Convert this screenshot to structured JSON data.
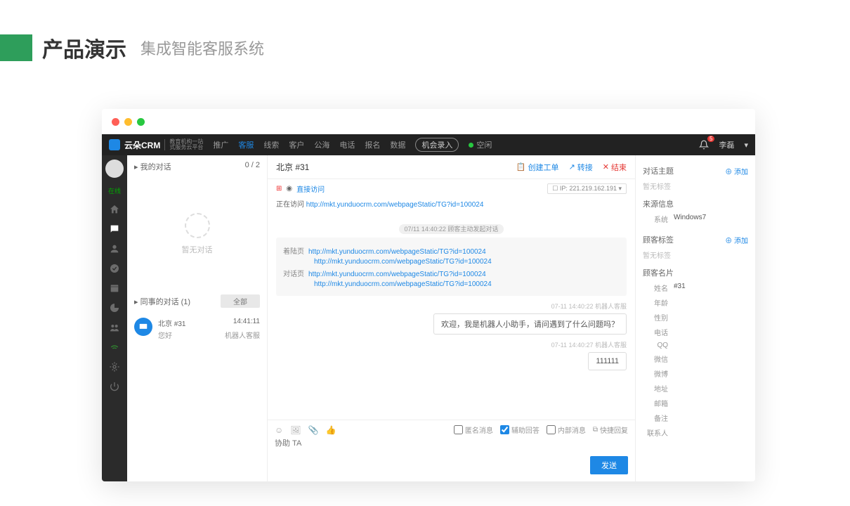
{
  "slide": {
    "title_main": "产品演示",
    "title_sub": "集成智能客服系统"
  },
  "brand": {
    "name": "云朵CRM",
    "sub1": "教育机构一站",
    "sub2": "式服务云平台"
  },
  "nav": {
    "items": [
      "推广",
      "客服",
      "线索",
      "客户",
      "公海",
      "电话",
      "报名",
      "数据"
    ],
    "active_index": 1,
    "record_btn": "机会录入",
    "status": "空闲",
    "user": "李磊",
    "badge": "5"
  },
  "rail": {
    "status": "在线"
  },
  "chats": {
    "my_header": "我的对话",
    "my_count": "0 / 2",
    "empty": "暂无对话",
    "peer_header": "同事的对话  (1)",
    "all_btn": "全部",
    "items": [
      {
        "title": "北京 #31",
        "time": "14:41:11",
        "preview": "您好",
        "agent": "机器人客服"
      }
    ]
  },
  "conv": {
    "title": "北京 #31",
    "actions": {
      "ticket": "创建工单",
      "transfer": "转接",
      "end": "结束"
    },
    "visit_label": "直接访问",
    "ip_label": "IP:",
    "ip": "221.219.162.191",
    "visiting_label": "正在访问",
    "visiting_url": "http://mkt.yunduocrm.com/webpageStatic/TG?id=100024",
    "sys_pill": "07/11 14:40:22  顾客主动发起对话",
    "info": {
      "landing_label": "着陆页",
      "landing_urls": [
        "http://mkt.yunduocrm.com/webpageStatic/TG?id=100024",
        "http://mkt.yunduocrm.com/webpageStatic/TG?id=100024"
      ],
      "dialog_label": "对话页",
      "dialog_urls": [
        "http://mkt.yunduocrm.com/webpageStatic/TG?id=100024",
        "http://mkt.yunduocrm.com/webpageStatic/TG?id=100024"
      ]
    },
    "msgs": [
      {
        "time": "07-11 14:40:22  机器人客服",
        "text": "欢迎，我是机器人小助手，请问遇到了什么问题吗？"
      },
      {
        "time": "07-11 14:40:27  机器人客服",
        "text": "111111"
      }
    ],
    "compose": {
      "placeholder": "协助 TA",
      "anon": "匿名消息",
      "assist": "辅助回答",
      "internal": "内部消息",
      "quick": "快捷回复",
      "send": "发送"
    }
  },
  "side": {
    "topic_hdr": "对话主题",
    "add": "添加",
    "no_tag": "暂无标签",
    "source_hdr": "来源信息",
    "system_lbl": "系统",
    "system_val": "Windows7",
    "cust_tag_hdr": "顾客标签",
    "card_hdr": "顾客名片",
    "fields": {
      "name_lbl": "姓名",
      "name_val": "#31",
      "age": "年龄",
      "gender": "性别",
      "phone": "电话",
      "qq": "QQ",
      "wechat": "微信",
      "weibo": "微博",
      "addr": "地址",
      "email": "邮箱",
      "remark": "备注",
      "contact": "联系人"
    }
  }
}
